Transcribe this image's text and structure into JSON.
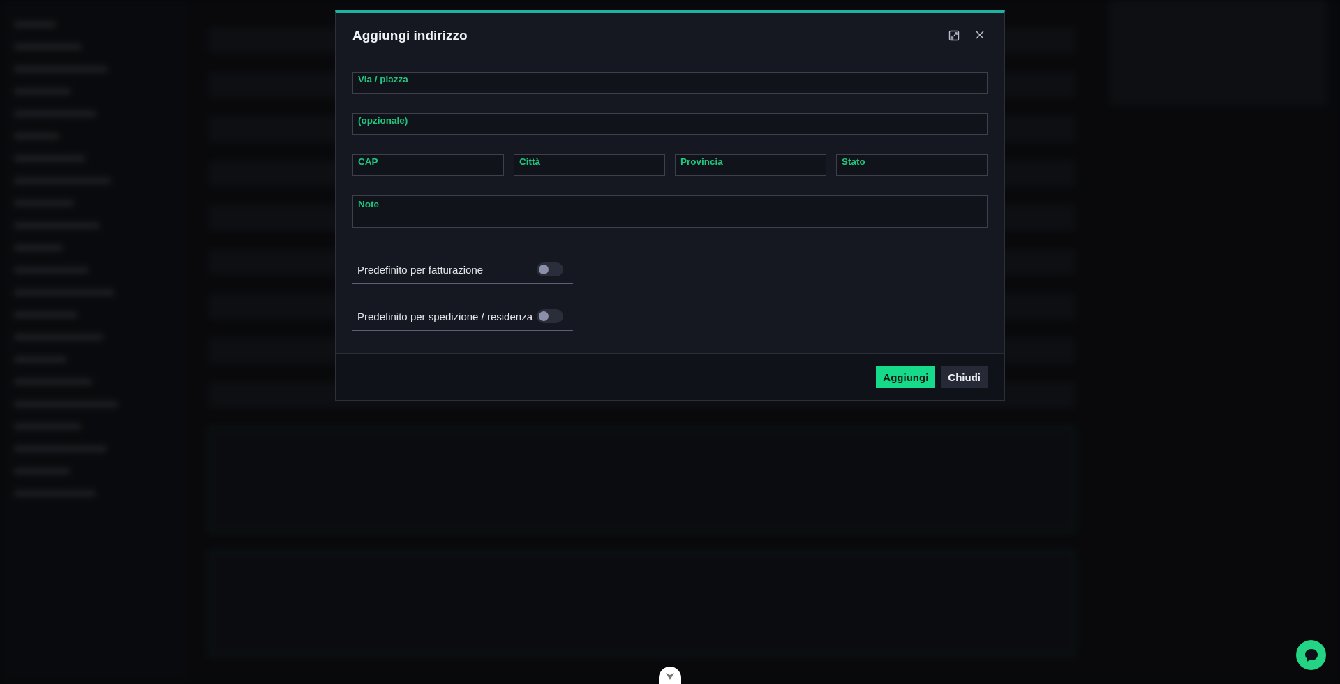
{
  "dialog": {
    "title": "Aggiungi indirizzo",
    "fields": [
      {
        "kind": "text",
        "placeholder": "Via / piazza"
      },
      {
        "kind": "text",
        "placeholder": "(opzionale)"
      },
      {
        "kind": "text",
        "placeholder": "CAP"
      },
      {
        "kind": "text",
        "placeholder": "Città"
      },
      {
        "kind": "text",
        "placeholder": "Provincia"
      },
      {
        "kind": "text",
        "placeholder": "Stato"
      },
      {
        "kind": "textarea",
        "placeholder": "Note"
      }
    ],
    "toggles": [
      {
        "label": "Predefinito per fatturazione",
        "on": false
      },
      {
        "label": "Predefinito per spedizione / residenza",
        "on": false
      }
    ],
    "buttons": [
      {
        "label": "Aggiungi",
        "kind": "primary"
      },
      {
        "label": "Chiudi",
        "kind": "secondary"
      }
    ]
  }
}
